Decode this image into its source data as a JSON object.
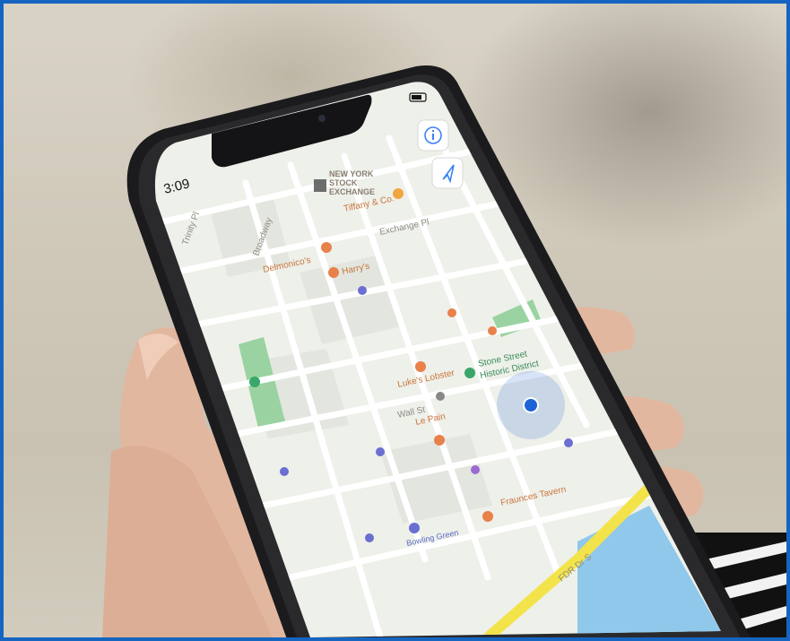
{
  "status_bar": {
    "time": "3:09"
  },
  "map": {
    "landmark_label_line1": "NEW YORK",
    "landmark_label_line2": "STOCK",
    "landmark_label_line3": "EXCHANGE",
    "streets": {
      "broadway": "Broadway",
      "trinity_pl": "Trinity Pl",
      "exchange_pl": "Exchange Pl",
      "fdr": "FDR Dr S"
    },
    "pois": {
      "tiffany": "Tiffany & Co.",
      "delmonicos": "Delmonico's",
      "harrys": "Harry's",
      "luke": "Luke's Lobster",
      "stone_street": "Stone Street",
      "stone_street_2": "Historic District",
      "wall_st": "Wall St",
      "le_pain": "Le Pain",
      "fraunces": "Fraunces Tavern",
      "bowling_green": "Bowling Green"
    },
    "route_color": "#f3e34a",
    "water_color": "#8fc8ea",
    "location_dot_color": "#1e63d6"
  },
  "colors": {
    "frame_border": "#1565c0",
    "phone_body": "#1b1b1d",
    "screen_bg": "#eef0ea"
  }
}
